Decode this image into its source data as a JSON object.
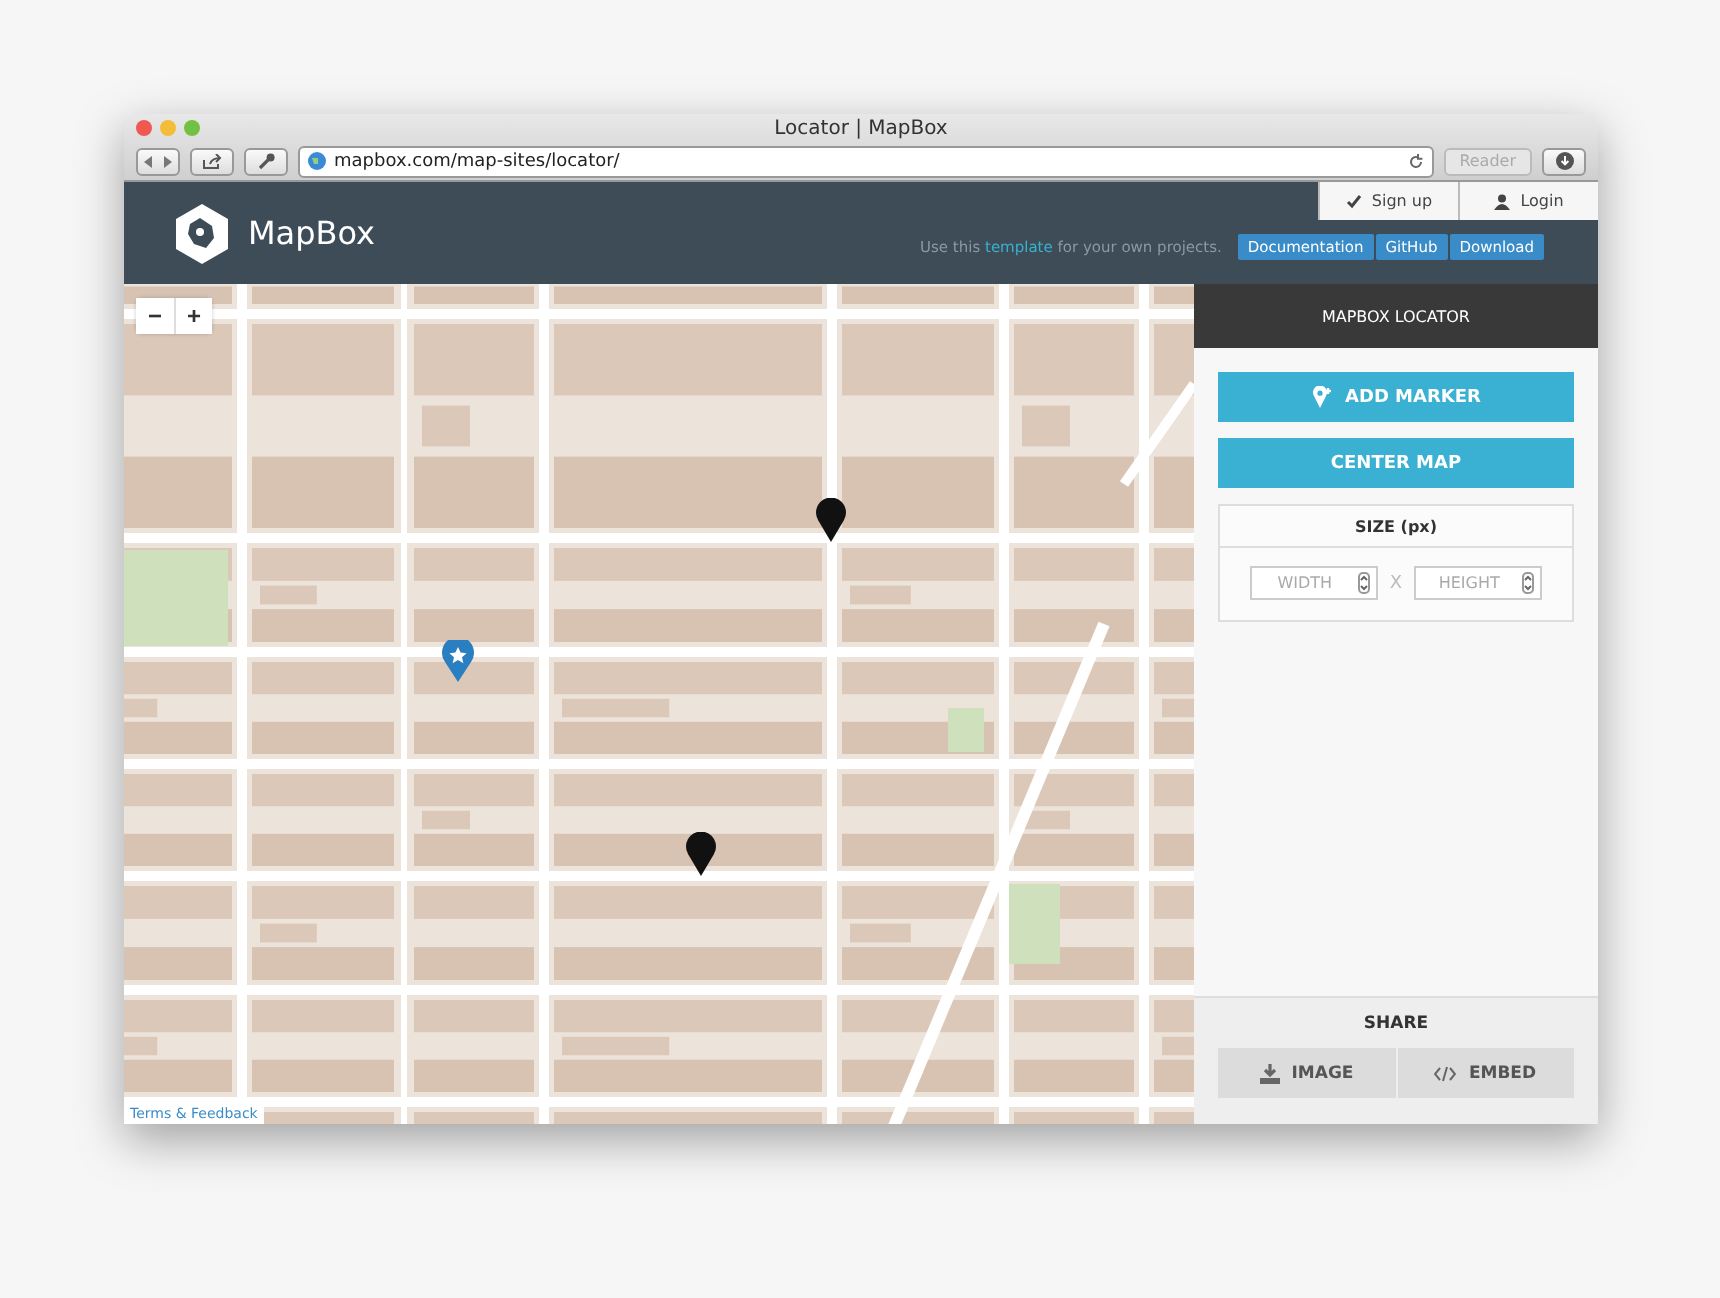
{
  "window": {
    "title": "Locator | MapBox"
  },
  "browser": {
    "url": "mapbox.com/map-sites/locator/",
    "reader_button": "Reader"
  },
  "header": {
    "logo": "MapBox",
    "auth": [
      {
        "label": "Sign up",
        "kind": "check"
      },
      {
        "label": "Login",
        "kind": "user"
      }
    ],
    "note_before": "Use this",
    "note_link": "template",
    "note_after": "for your own projects.",
    "links": [
      "Documentation",
      "GitHub",
      "Download"
    ]
  },
  "map": {
    "zoom_controls": [
      "−",
      "+"
    ],
    "attribution": "Terms & Feedback"
  },
  "sidebar": {
    "title": "MAPBOX LOCATOR",
    "buttons": [
      {
        "label": "ADD MARKER",
        "kind": "marker"
      },
      {
        "label": "CENTER MAP",
        "kind": "plain"
      }
    ],
    "size": {
      "label": "SIZE (px)",
      "width_placeholder": "WIDTH",
      "separator": "X",
      "height_placeholder": "HEIGHT"
    },
    "share": {
      "title": "SHARE",
      "buttons": [
        {
          "label": "IMAGE",
          "kind": "download"
        },
        {
          "label": "EMBED",
          "kind": "code"
        }
      ]
    }
  }
}
